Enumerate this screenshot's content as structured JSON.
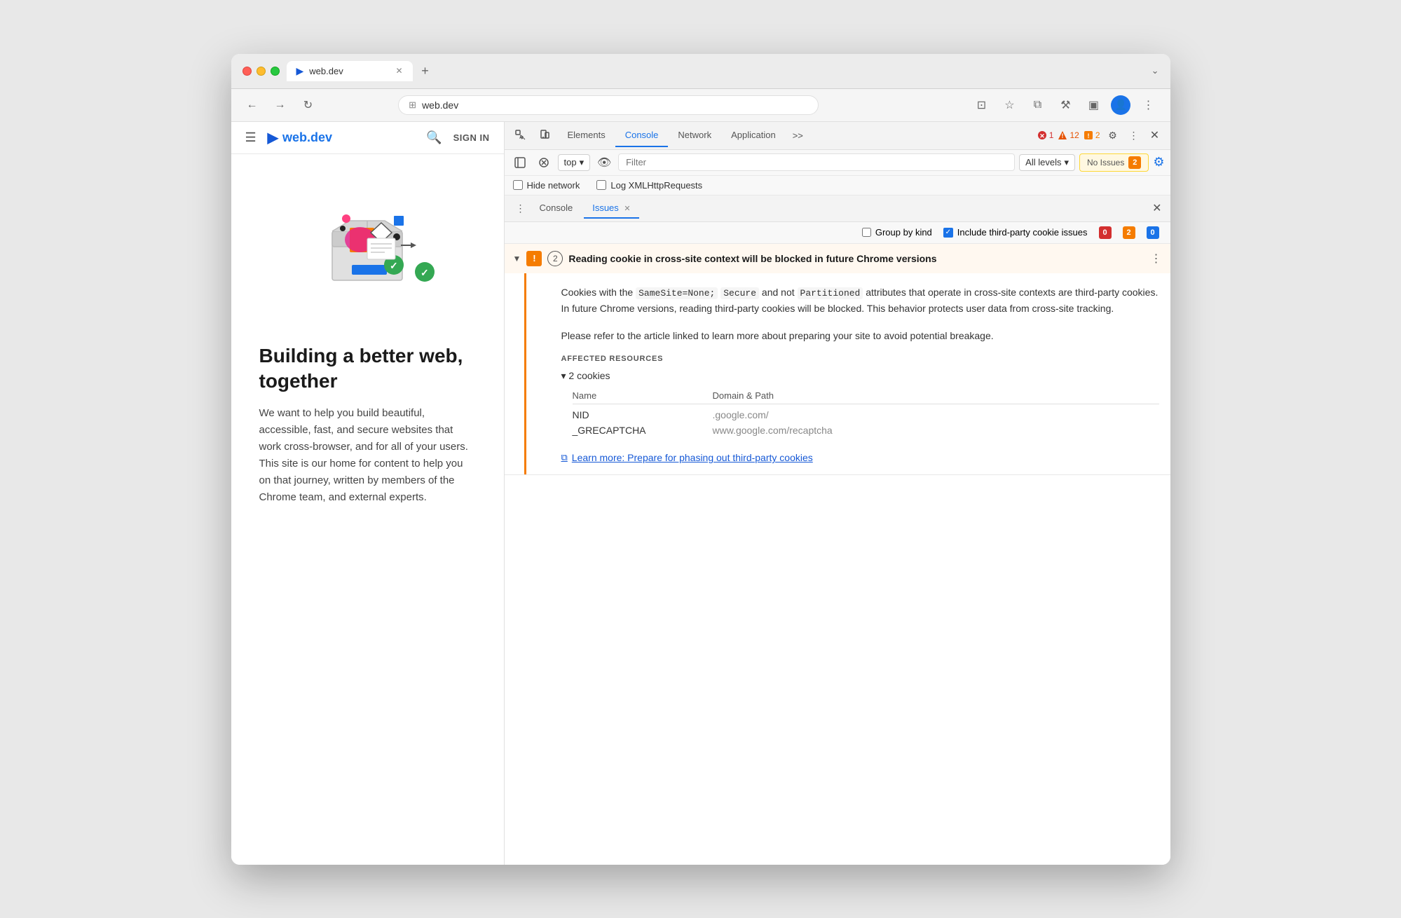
{
  "browser": {
    "tab_favicon": "▶",
    "tab_title": "web.dev",
    "tab_close": "✕",
    "new_tab": "+",
    "window_controls": "⌄"
  },
  "address_bar": {
    "back_icon": "←",
    "forward_icon": "→",
    "refresh_icon": "↻",
    "url_icon": "⊞",
    "url": "web.dev",
    "cast_icon": "⊡",
    "bookmark_icon": "☆",
    "extensions_icon": "⧉",
    "devtools_icon": "⚒",
    "sidebar_icon": "▣",
    "profile_icon": "👤",
    "menu_icon": "⋮"
  },
  "website": {
    "hamburger": "☰",
    "logo_icon": "▶",
    "logo_text": "web.dev",
    "search_icon": "🔍",
    "sign_in": "SIGN IN",
    "hero_title": "Building a better web, together",
    "hero_desc": "We want to help you build beautiful, accessible, fast, and secure websites that work cross-browser, and for all of your users. This site is our home for content to help you on that journey, written by members of the Chrome team, and external experts."
  },
  "devtools": {
    "toolbar": {
      "select_icon": "⬚",
      "device_icon": "📱",
      "tabs": [
        "Elements",
        "Console",
        "Network",
        "Application"
      ],
      "active_tab": "Console",
      "more_tabs": ">>",
      "error_count": "1",
      "warn_count": "12",
      "info_count": "2",
      "settings_icon": "⚙",
      "more_icon": "⋮",
      "close_icon": "✕"
    },
    "console_toolbar": {
      "clear_icon": "🚫",
      "top_label": "top",
      "dropdown_icon": "▾",
      "eye_icon": "👁",
      "filter_placeholder": "Filter",
      "all_levels": "All levels",
      "all_levels_dropdown": "▾",
      "no_issues_label": "No Issues",
      "no_issues_count": "2",
      "settings_gear": "⚙"
    },
    "hide_network": {
      "label": "Hide network",
      "log_xml": "Log XMLHttpRequests"
    },
    "issues_tabs": {
      "three_dots": "⋮",
      "console_tab": "Console",
      "issues_tab": "Issues",
      "issues_close": "✕",
      "close_panel": "✕"
    },
    "issues_options": {
      "group_by_kind": "Group by kind",
      "include_third_party": "Include third-party cookie issues",
      "count_0_red": "0",
      "count_2_orange": "2",
      "count_0_blue": "0"
    },
    "issue": {
      "expand_arrow": "▼",
      "warning_icon": "!",
      "count": "2",
      "title": "Reading cookie in cross-site context will be blocked in future Chrome versions",
      "more_icon": "⋮",
      "description_1": "Cookies with the ",
      "code_1": "SameSite=None;",
      "description_2": " ",
      "code_2": "Secure",
      "description_3": " and not ",
      "code_3": "Partitioned",
      "description_4": " attributes that operate in cross-site contexts are third-party cookies. In future Chrome versions, reading third-party cookies will be blocked. This behavior protects user data from cross-site tracking.",
      "description_para2": "Please refer to the article linked to learn more about preparing your site to avoid potential breakage.",
      "affected_label": "AFFECTED RESOURCES",
      "cookies_toggle": "▾ 2 cookies",
      "col_name": "Name",
      "col_domain": "Domain & Path",
      "cookie1_name": "NID",
      "cookie1_domain": ".google.com/",
      "cookie2_name": "_GRECAPTCHA",
      "cookie2_domain": "www.google.com/recaptcha",
      "learn_more_icon": "⧉",
      "learn_more_text": "Learn more: Prepare for phasing out third-party cookies"
    }
  }
}
